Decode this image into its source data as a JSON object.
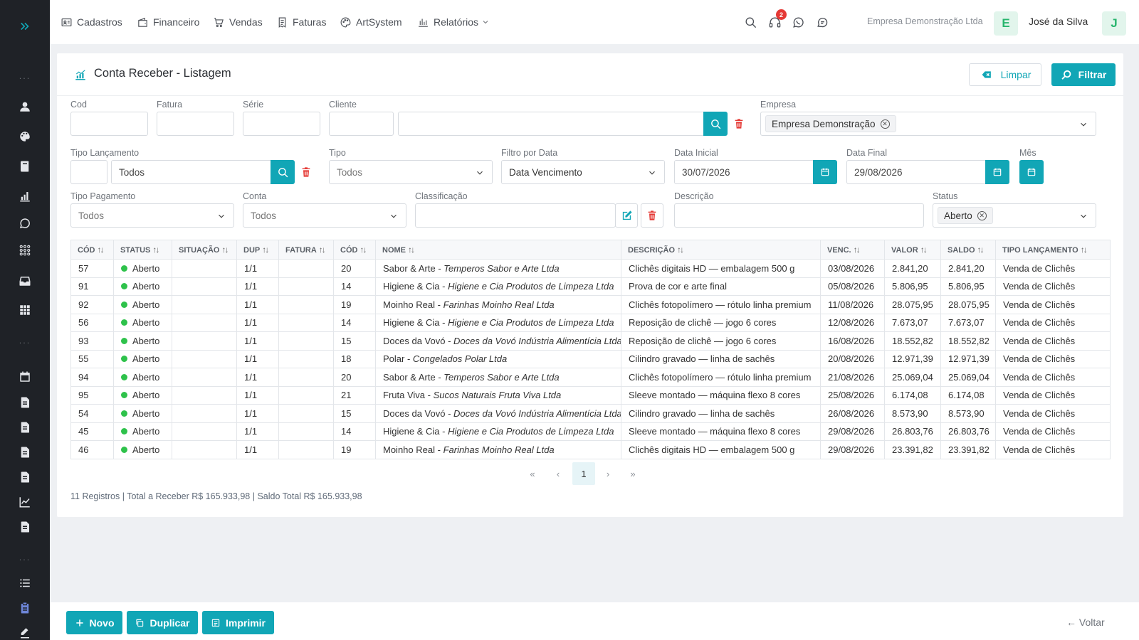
{
  "nav": {
    "items": [
      "Cadastros",
      "Financeiro",
      "Vendas",
      "Faturas",
      "ArtSystem",
      "Relatórios"
    ],
    "notification_count": "2",
    "company": "Empresa Demonstração Ltda",
    "company_initial": "E",
    "user": "José da Silva",
    "user_initial": "J"
  },
  "page": {
    "title": "Conta Receber - Listagem",
    "btn_clear": "Limpar",
    "btn_filter": "Filtrar"
  },
  "form": {
    "labels": {
      "cod": "Cod",
      "fatura": "Fatura",
      "serie": "Série",
      "cliente": "Cliente",
      "empresa": "Empresa",
      "tipo_lancamento": "Tipo Lançamento",
      "tipo": "Tipo",
      "filtro_data": "Filtro por Data",
      "data_inicial": "Data Inicial",
      "data_final": "Data Final",
      "mes": "Mês",
      "tipo_pagamento": "Tipo Pagamento",
      "conta": "Conta",
      "classificacao": "Classificação",
      "descricao": "Descrição",
      "status": "Status"
    },
    "empresa_chip": "Empresa Demonstração",
    "tipo_lancamento_value": "Todos",
    "tipo_value": "Todos",
    "filtro_data_value": "Data Vencimento",
    "data_inicial_value": "30/07/2026",
    "data_final_value": "29/08/2026",
    "tipo_pagamento_value": "Todos",
    "conta_value": "Todos",
    "status_chip": "Aberto"
  },
  "table": {
    "columns": [
      "Cód",
      "Status",
      "Situação",
      "Dup",
      "Fatura",
      "Cód",
      "Nome",
      "Descrição",
      "Venc.",
      "Valor",
      "Saldo",
      "Tipo Lançamento"
    ],
    "rows": [
      {
        "cod": "57",
        "status": "Aberto",
        "situacao": "",
        "dup": "1/1",
        "fatura": "",
        "cod2": "20",
        "nome": "Sabor & Arte",
        "razao": "Temperos Sabor e Arte Ltda",
        "descricao": "Clichês digitais HD — embalagem 500 g",
        "venc": "03/08/2026",
        "vencido": true,
        "valor": "2.841,20",
        "saldo": "2.841,20",
        "tipo": "Venda de Clichês"
      },
      {
        "cod": "91",
        "status": "Aberto",
        "situacao": "",
        "dup": "1/1",
        "fatura": "",
        "cod2": "14",
        "nome": "Higiene & Cia",
        "razao": "Higiene e Cia Produtos de Limpeza Ltda",
        "descricao": "Prova de cor e arte final",
        "venc": "05/08/2026",
        "vencido": true,
        "valor": "5.806,95",
        "saldo": "5.806,95",
        "tipo": "Venda de Clichês"
      },
      {
        "cod": "92",
        "status": "Aberto",
        "situacao": "",
        "dup": "1/1",
        "fatura": "",
        "cod2": "19",
        "nome": "Moinho Real",
        "razao": "Farinhas Moinho Real Ltda",
        "descricao": "Clichês fotopolímero — rótulo linha premium",
        "venc": "11/08/2026",
        "vencido": true,
        "valor": "28.075,95",
        "saldo": "28.075,95",
        "tipo": "Venda de Clichês"
      },
      {
        "cod": "56",
        "status": "Aberto",
        "situacao": "",
        "dup": "1/1",
        "fatura": "",
        "cod2": "14",
        "nome": "Higiene & Cia",
        "razao": "Higiene e Cia Produtos de Limpeza Ltda",
        "descricao": "Reposição de clichê — jogo 6 cores",
        "venc": "12/08/2026",
        "vencido": true,
        "valor": "7.673,07",
        "saldo": "7.673,07",
        "tipo": "Venda de Clichês"
      },
      {
        "cod": "93",
        "status": "Aberto",
        "situacao": "",
        "dup": "1/1",
        "fatura": "",
        "cod2": "15",
        "nome": "Doces da Vovó",
        "razao": "Doces da Vovó Indústria Alimentícia Ltda",
        "descricao": "Reposição de clichê — jogo 6 cores",
        "venc": "16/08/2026",
        "vencido": true,
        "valor": "18.552,82",
        "saldo": "18.552,82",
        "tipo": "Venda de Clichês"
      },
      {
        "cod": "55",
        "status": "Aberto",
        "situacao": "",
        "dup": "1/1",
        "fatura": "",
        "cod2": "18",
        "nome": "Polar",
        "razao": "Congelados Polar Ltda",
        "descricao": "Cilindro gravado — linha de sachês",
        "venc": "20/08/2026",
        "vencido": true,
        "valor": "12.971,39",
        "saldo": "12.971,39",
        "tipo": "Venda de Clichês"
      },
      {
        "cod": "94",
        "status": "Aberto",
        "situacao": "",
        "dup": "1/1",
        "fatura": "",
        "cod2": "20",
        "nome": "Sabor & Arte",
        "razao": "Temperos Sabor e Arte Ltda",
        "descricao": "Clichês fotopolímero — rótulo linha premium",
        "venc": "21/08/2026",
        "vencido": true,
        "valor": "25.069,04",
        "saldo": "25.069,04",
        "tipo": "Venda de Clichês"
      },
      {
        "cod": "95",
        "status": "Aberto",
        "situacao": "",
        "dup": "1/1",
        "fatura": "",
        "cod2": "21",
        "nome": "Fruta Viva",
        "razao": "Sucos Naturais Fruta Viva Ltda",
        "descricao": "Sleeve montado — máquina flexo 8 cores",
        "venc": "25/08/2026",
        "vencido": true,
        "valor": "6.174,08",
        "saldo": "6.174,08",
        "tipo": "Venda de Clichês"
      },
      {
        "cod": "54",
        "status": "Aberto",
        "situacao": "",
        "dup": "1/1",
        "fatura": "",
        "cod2": "15",
        "nome": "Doces da Vovó",
        "razao": "Doces da Vovó Indústria Alimentícia Ltda",
        "descricao": "Cilindro gravado — linha de sachês",
        "venc": "26/08/2026",
        "vencido": true,
        "valor": "8.573,90",
        "saldo": "8.573,90",
        "tipo": "Venda de Clichês"
      },
      {
        "cod": "45",
        "status": "Aberto",
        "situacao": "",
        "dup": "1/1",
        "fatura": "",
        "cod2": "14",
        "nome": "Higiene & Cia",
        "razao": "Higiene e Cia Produtos de Limpeza Ltda",
        "descricao": "Sleeve montado — máquina flexo 8 cores",
        "venc": "29/08/2026",
        "vencido": false,
        "valor": "26.803,76",
        "saldo": "26.803,76",
        "tipo": "Venda de Clichês"
      },
      {
        "cod": "46",
        "status": "Aberto",
        "situacao": "",
        "dup": "1/1",
        "fatura": "",
        "cod2": "19",
        "nome": "Moinho Real",
        "razao": "Farinhas Moinho Real Ltda",
        "descricao": "Clichês digitais HD — embalagem 500 g",
        "venc": "29/08/2026",
        "vencido": false,
        "valor": "23.391,82",
        "saldo": "23.391,82",
        "tipo": "Venda de Clichês"
      }
    ]
  },
  "pagination": {
    "first": "«",
    "prev": "‹",
    "current": "1",
    "next": "›",
    "last": "»"
  },
  "summary": "11 Registros | Total a Receber R$ 165.933,98 | Saldo Total R$ 165.933,98",
  "footer": {
    "novo": "Novo",
    "duplicar": "Duplicar",
    "imprimir": "Imprimir",
    "voltar": "Voltar"
  },
  "colors": {
    "accent": "#11a6b6",
    "danger": "#e53935",
    "status_ok": "#2ec24b",
    "sidebar": "#1f2227"
  }
}
